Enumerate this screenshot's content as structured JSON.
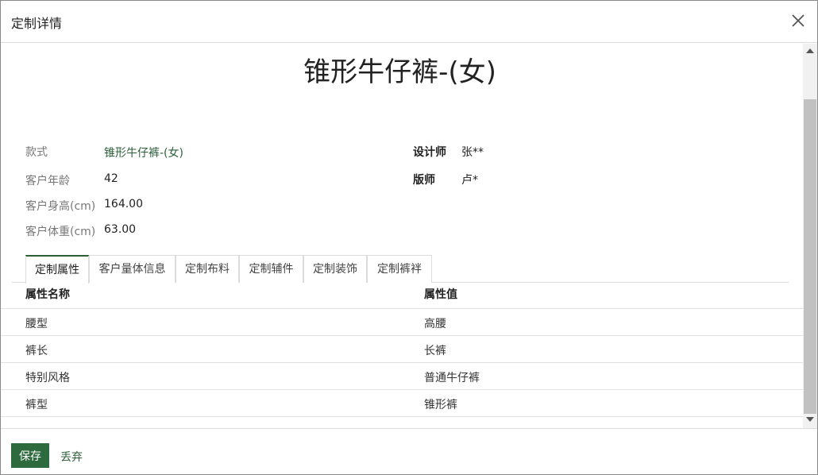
{
  "dialog": {
    "title": "定制详情",
    "close_icon": "close-icon"
  },
  "product": {
    "title": "锥形牛仔裤-(女)"
  },
  "fields": {
    "style_label": "款式",
    "style_value": "锥形牛仔裤-(女)",
    "age_label": "客户年龄",
    "age_value": "42",
    "height_label": "客户身高(cm)",
    "height_value": "164.00",
    "weight_label": "客户体重(cm)",
    "weight_value": "63.00",
    "designer_label": "设计师",
    "designer_value": "张**",
    "patternmaker_label": "版师",
    "patternmaker_value": "卢*"
  },
  "tabs": [
    {
      "label": "定制属性",
      "active": true
    },
    {
      "label": "客户量体信息",
      "active": false
    },
    {
      "label": "定制布料",
      "active": false
    },
    {
      "label": "定制辅件",
      "active": false
    },
    {
      "label": "定制装饰",
      "active": false
    },
    {
      "label": "定制裤袢",
      "active": false
    }
  ],
  "table": {
    "headers": {
      "name": "属性名称",
      "value": "属性值"
    },
    "rows": [
      {
        "name": "腰型",
        "value": "高腰"
      },
      {
        "name": "裤长",
        "value": "长裤"
      },
      {
        "name": "特别风格",
        "value": "普通牛仔裤"
      },
      {
        "name": "裤型",
        "value": "锥形裤"
      }
    ]
  },
  "footer": {
    "save_label": "保存",
    "discard_label": "丢弃"
  },
  "colors": {
    "accent": "#2d6a3e",
    "link": "#2d5e3a"
  }
}
